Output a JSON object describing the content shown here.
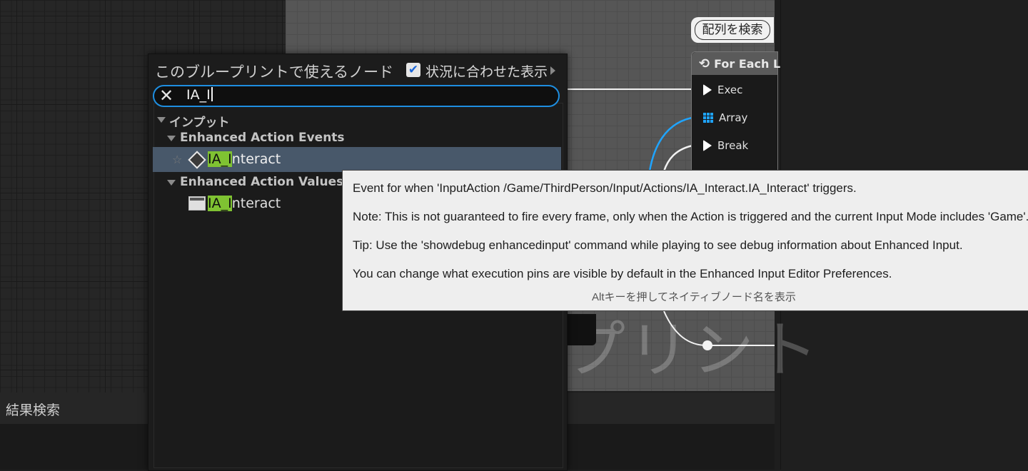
{
  "graph": {
    "watermark": "プリント",
    "search_array_button": "配列を検索",
    "node": {
      "title": "For Each L",
      "pins": [
        "Exec",
        "Array",
        "Break"
      ]
    }
  },
  "results_panel": {
    "title": "結果検索"
  },
  "palette": {
    "title": "このブループリントで使えるノード",
    "context_sensitive_label": "状況に合わせた表示",
    "context_sensitive_checked": true,
    "search": {
      "value": "IA_I"
    },
    "tree": {
      "category": "インプット",
      "groups": [
        {
          "label": "Enhanced Action Events",
          "items": [
            {
              "highlight": "IA_I",
              "rest": "nteract",
              "icon": "event-icon",
              "selected": true
            }
          ]
        },
        {
          "label": "Enhanced Action Values",
          "items": [
            {
              "highlight": "IA_I",
              "rest": "nteract",
              "icon": "variable-icon",
              "selected": false
            }
          ]
        }
      ]
    }
  },
  "tooltip": {
    "lines": [
      "Event for when 'InputAction /Game/ThirdPerson/Input/Actions/IA_Interact.IA_Interact' triggers.",
      "Note: This is not guaranteed to fire every frame, only when the Action is triggered and the current Input Mode includes 'Game'.",
      "Tip: Use the 'showdebug enhancedinput' command while playing to see debug information about Enhanced Input.",
      "You can change what execution pins are visible by default in the Enhanced Input Editor Preferences."
    ],
    "footer": "Altキーを押してネイティブノード名を表示"
  },
  "colors": {
    "accent": "#1e8ee0",
    "highlight": "#7fc232",
    "selected_row": "#48586a",
    "array_pin": "#1fa4ff"
  }
}
